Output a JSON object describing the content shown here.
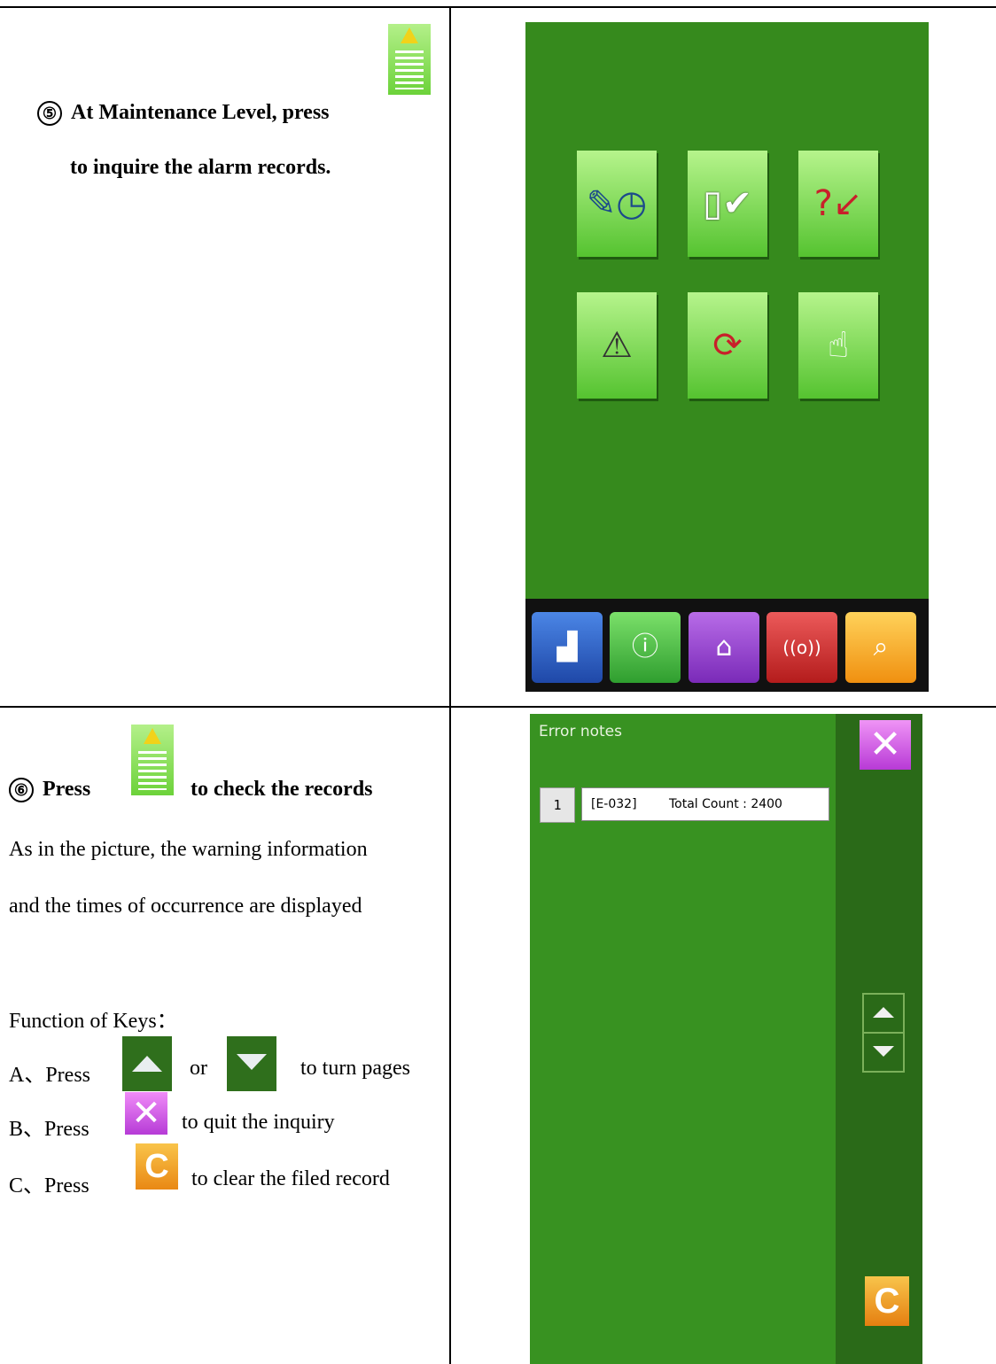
{
  "step5": {
    "number": "⑤",
    "line1": "At Maintenance Level, press",
    "line2": "to inquire the alarm records."
  },
  "step6": {
    "number": "⑥",
    "press": "Press",
    "suffix": "to check the records",
    "desc1": "As in the picture, the warning information",
    "desc2": "and the times of occurrence are displayed",
    "keys_title": "Function of Keys：",
    "key_a_prefix": "A、Press",
    "key_a_or": "or",
    "key_a_suffix": "to turn pages",
    "key_b_prefix": "B、Press",
    "key_b_suffix": "to quit the inquiry",
    "key_c_prefix": "C、Press",
    "key_c_suffix": "to clear the filed record"
  },
  "icons": {
    "alarm_key": "alarm-records-icon",
    "up_key": "page-up-icon",
    "down_key": "page-down-icon",
    "close_key": "close-icon",
    "clear_key": "clear-icon"
  },
  "screen1": {
    "background": "#368a1d",
    "tiles": [
      "maintenance-time-icon",
      "pattern-check-icon",
      "needle-help-icon",
      "alarm-records-icon",
      "machine-cycle-icon",
      "counter-input-icon"
    ],
    "bottom_buttons": [
      {
        "name": "sewing-machine-icon",
        "color": "#2d5fc8"
      },
      {
        "name": "info-icon",
        "color": "#3cb43c"
      },
      {
        "name": "home-icon",
        "color": "#8e3ec8"
      },
      {
        "name": "signal-icon",
        "color": "#d52a2a"
      },
      {
        "name": "search-icon",
        "color": "#f2a31c"
      }
    ]
  },
  "screen2": {
    "title": "Error notes",
    "row_number": "1",
    "error_code": "[E-032]",
    "total_count": "Total Count : 2400",
    "clear_label": "C"
  }
}
